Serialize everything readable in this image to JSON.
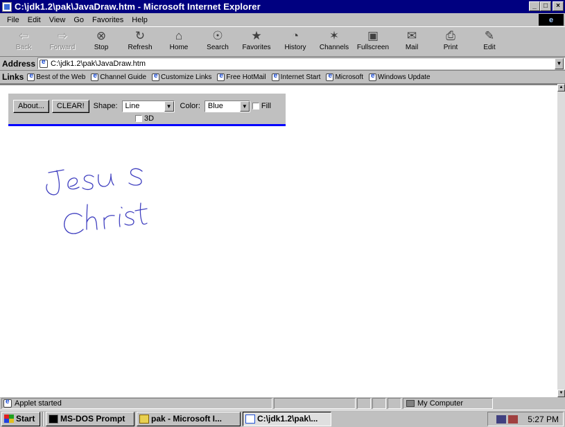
{
  "window": {
    "title": "C:\\jdk1.2\\pak\\JavaDraw.htm - Microsoft Internet Explorer",
    "controls": [
      "_",
      "□",
      "×"
    ]
  },
  "menu": [
    "File",
    "Edit",
    "View",
    "Go",
    "Favorites",
    "Help"
  ],
  "toolbar": [
    {
      "label": "Back",
      "icon": "back-arrow-icon",
      "glyph": "⇦",
      "disabled": true
    },
    {
      "label": "Forward",
      "icon": "forward-arrow-icon",
      "glyph": "⇨",
      "disabled": true
    },
    {
      "label": "Stop",
      "icon": "stop-icon",
      "glyph": "⊗"
    },
    {
      "label": "Refresh",
      "icon": "refresh-icon",
      "glyph": "↻"
    },
    {
      "label": "Home",
      "icon": "home-icon",
      "glyph": "⌂"
    },
    {
      "label": "Search",
      "icon": "search-icon",
      "glyph": "☉"
    },
    {
      "label": "Favorites",
      "icon": "favorites-icon",
      "glyph": "★"
    },
    {
      "label": "History",
      "icon": "history-icon",
      "glyph": "◔"
    },
    {
      "label": "Channels",
      "icon": "channels-icon",
      "glyph": "✶"
    },
    {
      "label": "Fullscreen",
      "icon": "fullscreen-icon",
      "glyph": "▣"
    },
    {
      "label": "Mail",
      "icon": "mail-icon",
      "glyph": "✉"
    },
    {
      "label": "Print",
      "icon": "print-icon",
      "glyph": "⎙"
    },
    {
      "label": "Edit",
      "icon": "edit-icon",
      "glyph": "✎"
    }
  ],
  "address": {
    "label": "Address",
    "value": "C:\\jdk1.2\\pak\\JavaDraw.htm"
  },
  "links": {
    "label": "Links",
    "items": [
      "Best of the Web",
      "Channel Guide",
      "Customize Links",
      "Free HotMail",
      "Internet Start",
      "Microsoft",
      "Windows Update"
    ]
  },
  "applet": {
    "about_label": "About...",
    "clear_label": "CLEAR!",
    "shape_label": "Shape:",
    "shape_value": "Line",
    "color_label": "Color:",
    "color_value": "Blue",
    "fill_label": "Fill",
    "threed_label": "3D",
    "accent_color": "#0000ff"
  },
  "drawing": {
    "stroke_color": "#4040c0",
    "handwriting_words": [
      "Jesus",
      "Christ"
    ]
  },
  "status": {
    "text": "Applet started",
    "zone": "My Computer"
  },
  "taskbar": {
    "start_label": "Start",
    "buttons": [
      "MS-DOS Prompt",
      "pak - Microsoft I...",
      "C:\\jdk1.2\\pak\\..."
    ],
    "time": "5:27 PM"
  }
}
